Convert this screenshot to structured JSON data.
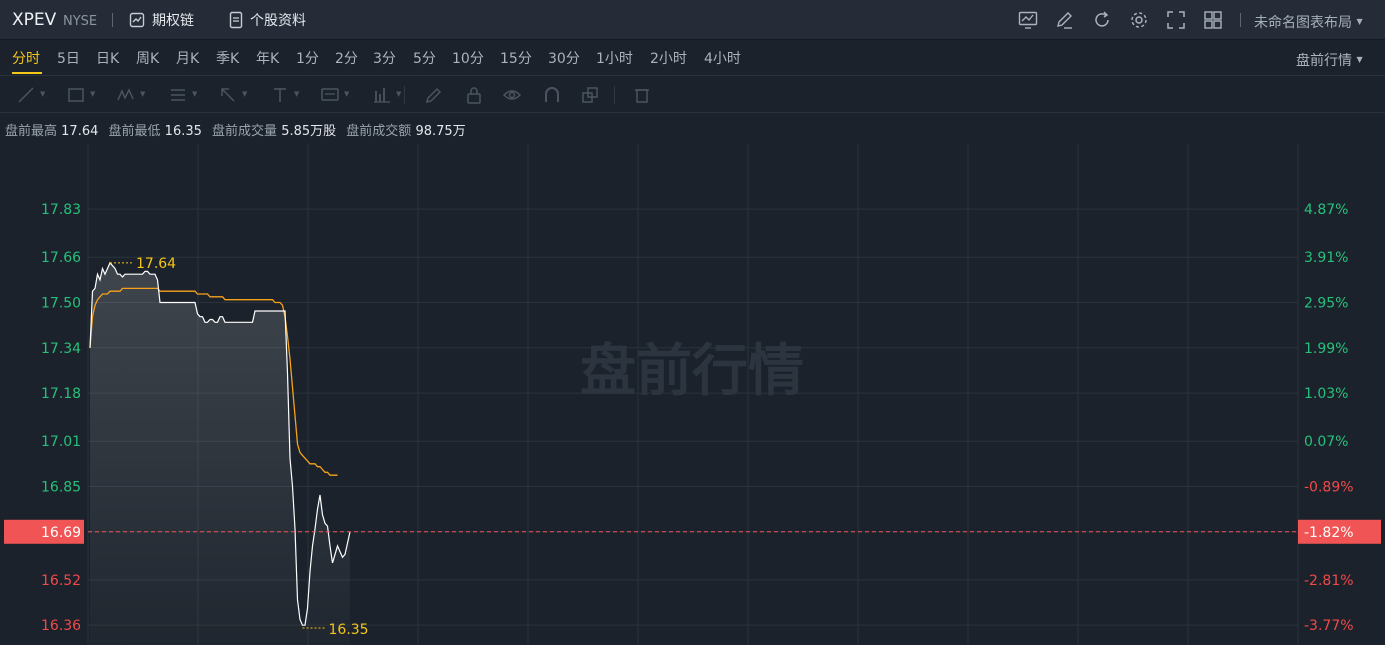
{
  "header": {
    "symbol": "XPEV",
    "exchange": "NYSE",
    "options_chain": "期权链",
    "company_profile": "个股资料",
    "layout_name": "未命名图表布局",
    "icons": [
      "indicator-icon",
      "draw-icon",
      "refresh-icon",
      "settings-icon",
      "fullscreen-icon",
      "grid-layout-icon"
    ]
  },
  "periods": {
    "items": [
      "分时",
      "5日",
      "日K",
      "周K",
      "月K",
      "季K",
      "年K",
      "1分",
      "2分",
      "3分",
      "5分",
      "10分",
      "15分",
      "30分",
      "1小时",
      "2小时",
      "4小时"
    ],
    "active": "分时",
    "session": "盘前行情"
  },
  "drawing_tools": [
    "trend-line-icon",
    "rectangle-icon",
    "wave-icon",
    "fibonacci-icon",
    "arrow-icon",
    "text-icon",
    "annotation-icon",
    "measure-icon",
    "pen-icon",
    "lock-icon",
    "eye-icon",
    "magnet-icon",
    "layers-icon",
    "trash-icon"
  ],
  "info_bar": {
    "high_label": "盘前最高",
    "high": "17.64",
    "low_label": "盘前最低",
    "low": "16.35",
    "vol_label": "盘前成交量",
    "vol": "5.85万股",
    "amount_label": "盘前成交额",
    "amount": "98.75万"
  },
  "chart_data": {
    "type": "line",
    "watermark": "盘前行情",
    "ylim": [
      16.29,
      18.06
    ],
    "y_ticks": [
      "17.83",
      "17.66",
      "17.50",
      "17.34",
      "17.18",
      "17.01",
      "16.85",
      "16.69",
      "16.52",
      "16.36"
    ],
    "pct_ticks": [
      "4.87%",
      "3.91%",
      "2.95%",
      "1.99%",
      "1.03%",
      "0.07%",
      "-0.89%",
      "-1.82%",
      "-2.81%",
      "-3.77%"
    ],
    "current_price": "16.69",
    "current_pct": "-1.82%",
    "high_label": "17.64",
    "low_label": "16.35",
    "colors": {
      "up": "#26c07a",
      "down": "#f04a4a",
      "price": "#ffffff",
      "avg": "#f7a21b",
      "marker": "#f5c518",
      "current_bg": "#f05454"
    },
    "n_slots": 110,
    "price_series": [
      17.34,
      17.54,
      17.55,
      17.6,
      17.58,
      17.62,
      17.6,
      17.62,
      17.64,
      17.63,
      17.62,
      17.6,
      17.6,
      17.59,
      17.6,
      17.6,
      17.6,
      17.6,
      17.6,
      17.6,
      17.6,
      17.6,
      17.61,
      17.61,
      17.6,
      17.6,
      17.6,
      17.58,
      17.5,
      17.5,
      17.5,
      17.5,
      17.5,
      17.5,
      17.5,
      17.5,
      17.5,
      17.5,
      17.5,
      17.5,
      17.5,
      17.5,
      17.5,
      17.46,
      17.45,
      17.45,
      17.43,
      17.43,
      17.44,
      17.44,
      17.43,
      17.43,
      17.45,
      17.45,
      17.43,
      17.43,
      17.43,
      17.43,
      17.43,
      17.43,
      17.43,
      17.43,
      17.43,
      17.43,
      17.43,
      17.43,
      17.47,
      17.47,
      17.47,
      17.47,
      17.47,
      17.47,
      17.47,
      17.47,
      17.47,
      17.47,
      17.47,
      17.47,
      17.47,
      17.25,
      16.95,
      16.85,
      16.7,
      16.45,
      16.38,
      16.36,
      16.36,
      16.42,
      16.55,
      16.64,
      16.7,
      16.77,
      16.82,
      16.75,
      16.72,
      16.71,
      16.64,
      16.58,
      16.61,
      16.64,
      16.62,
      16.6,
      16.61,
      16.65,
      16.69
    ],
    "avg_series": [
      17.34,
      17.45,
      17.49,
      17.51,
      17.52,
      17.53,
      17.53,
      17.53,
      17.54,
      17.54,
      17.54,
      17.54,
      17.54,
      17.55,
      17.55,
      17.55,
      17.55,
      17.55,
      17.55,
      17.55,
      17.55,
      17.55,
      17.55,
      17.55,
      17.55,
      17.55,
      17.55,
      17.55,
      17.54,
      17.54,
      17.54,
      17.54,
      17.54,
      17.54,
      17.54,
      17.54,
      17.54,
      17.54,
      17.54,
      17.54,
      17.54,
      17.54,
      17.54,
      17.53,
      17.53,
      17.53,
      17.53,
      17.53,
      17.52,
      17.52,
      17.52,
      17.52,
      17.52,
      17.52,
      17.51,
      17.51,
      17.51,
      17.51,
      17.51,
      17.51,
      17.51,
      17.51,
      17.51,
      17.51,
      17.51,
      17.51,
      17.51,
      17.51,
      17.51,
      17.51,
      17.51,
      17.51,
      17.51,
      17.51,
      17.5,
      17.5,
      17.5,
      17.49,
      17.45,
      17.38,
      17.3,
      17.2,
      17.1,
      17.0,
      16.97,
      16.96,
      16.95,
      16.94,
      16.93,
      16.93,
      16.93,
      16.92,
      16.92,
      16.91,
      16.9,
      16.9,
      16.89,
      16.89,
      16.89,
      16.89
    ]
  }
}
